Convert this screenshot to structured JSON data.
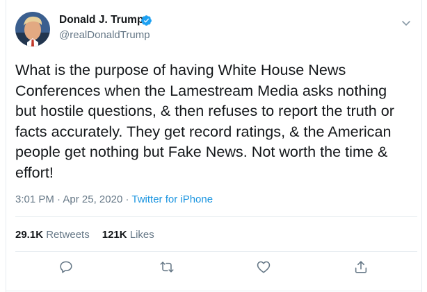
{
  "author": {
    "display_name": "Donald J. Trump",
    "handle": "@realDonaldTrump",
    "verified": true
  },
  "tweet": {
    "text": "What is the purpose of having White House News\nConferences when the Lamestream Media asks nothing\nbut hostile questions, & then refuses to report the truth or\nfacts accurately. They get record ratings, & the American\npeople get nothing but Fake News. Not worth the time &\neffort!",
    "time": "3:01 PM",
    "separator_1": " · ",
    "date": "Apr 25, 2020",
    "separator_2": " · ",
    "source": "Twitter for iPhone"
  },
  "stats": {
    "retweets_count": "29.1K",
    "retweets_label": " Retweets",
    "likes_count": "121K",
    "likes_label": " Likes"
  },
  "icons": {
    "verified": "verified-badge-icon",
    "caret": "chevron-down-icon",
    "reply": "reply-icon",
    "retweet": "retweet-icon",
    "like": "heart-icon",
    "share": "share-icon"
  },
  "colors": {
    "text_primary": "#14171a",
    "text_secondary": "#657786",
    "link": "#1b95e0",
    "verified": "#1da1f2",
    "border": "#e6ecf0"
  }
}
